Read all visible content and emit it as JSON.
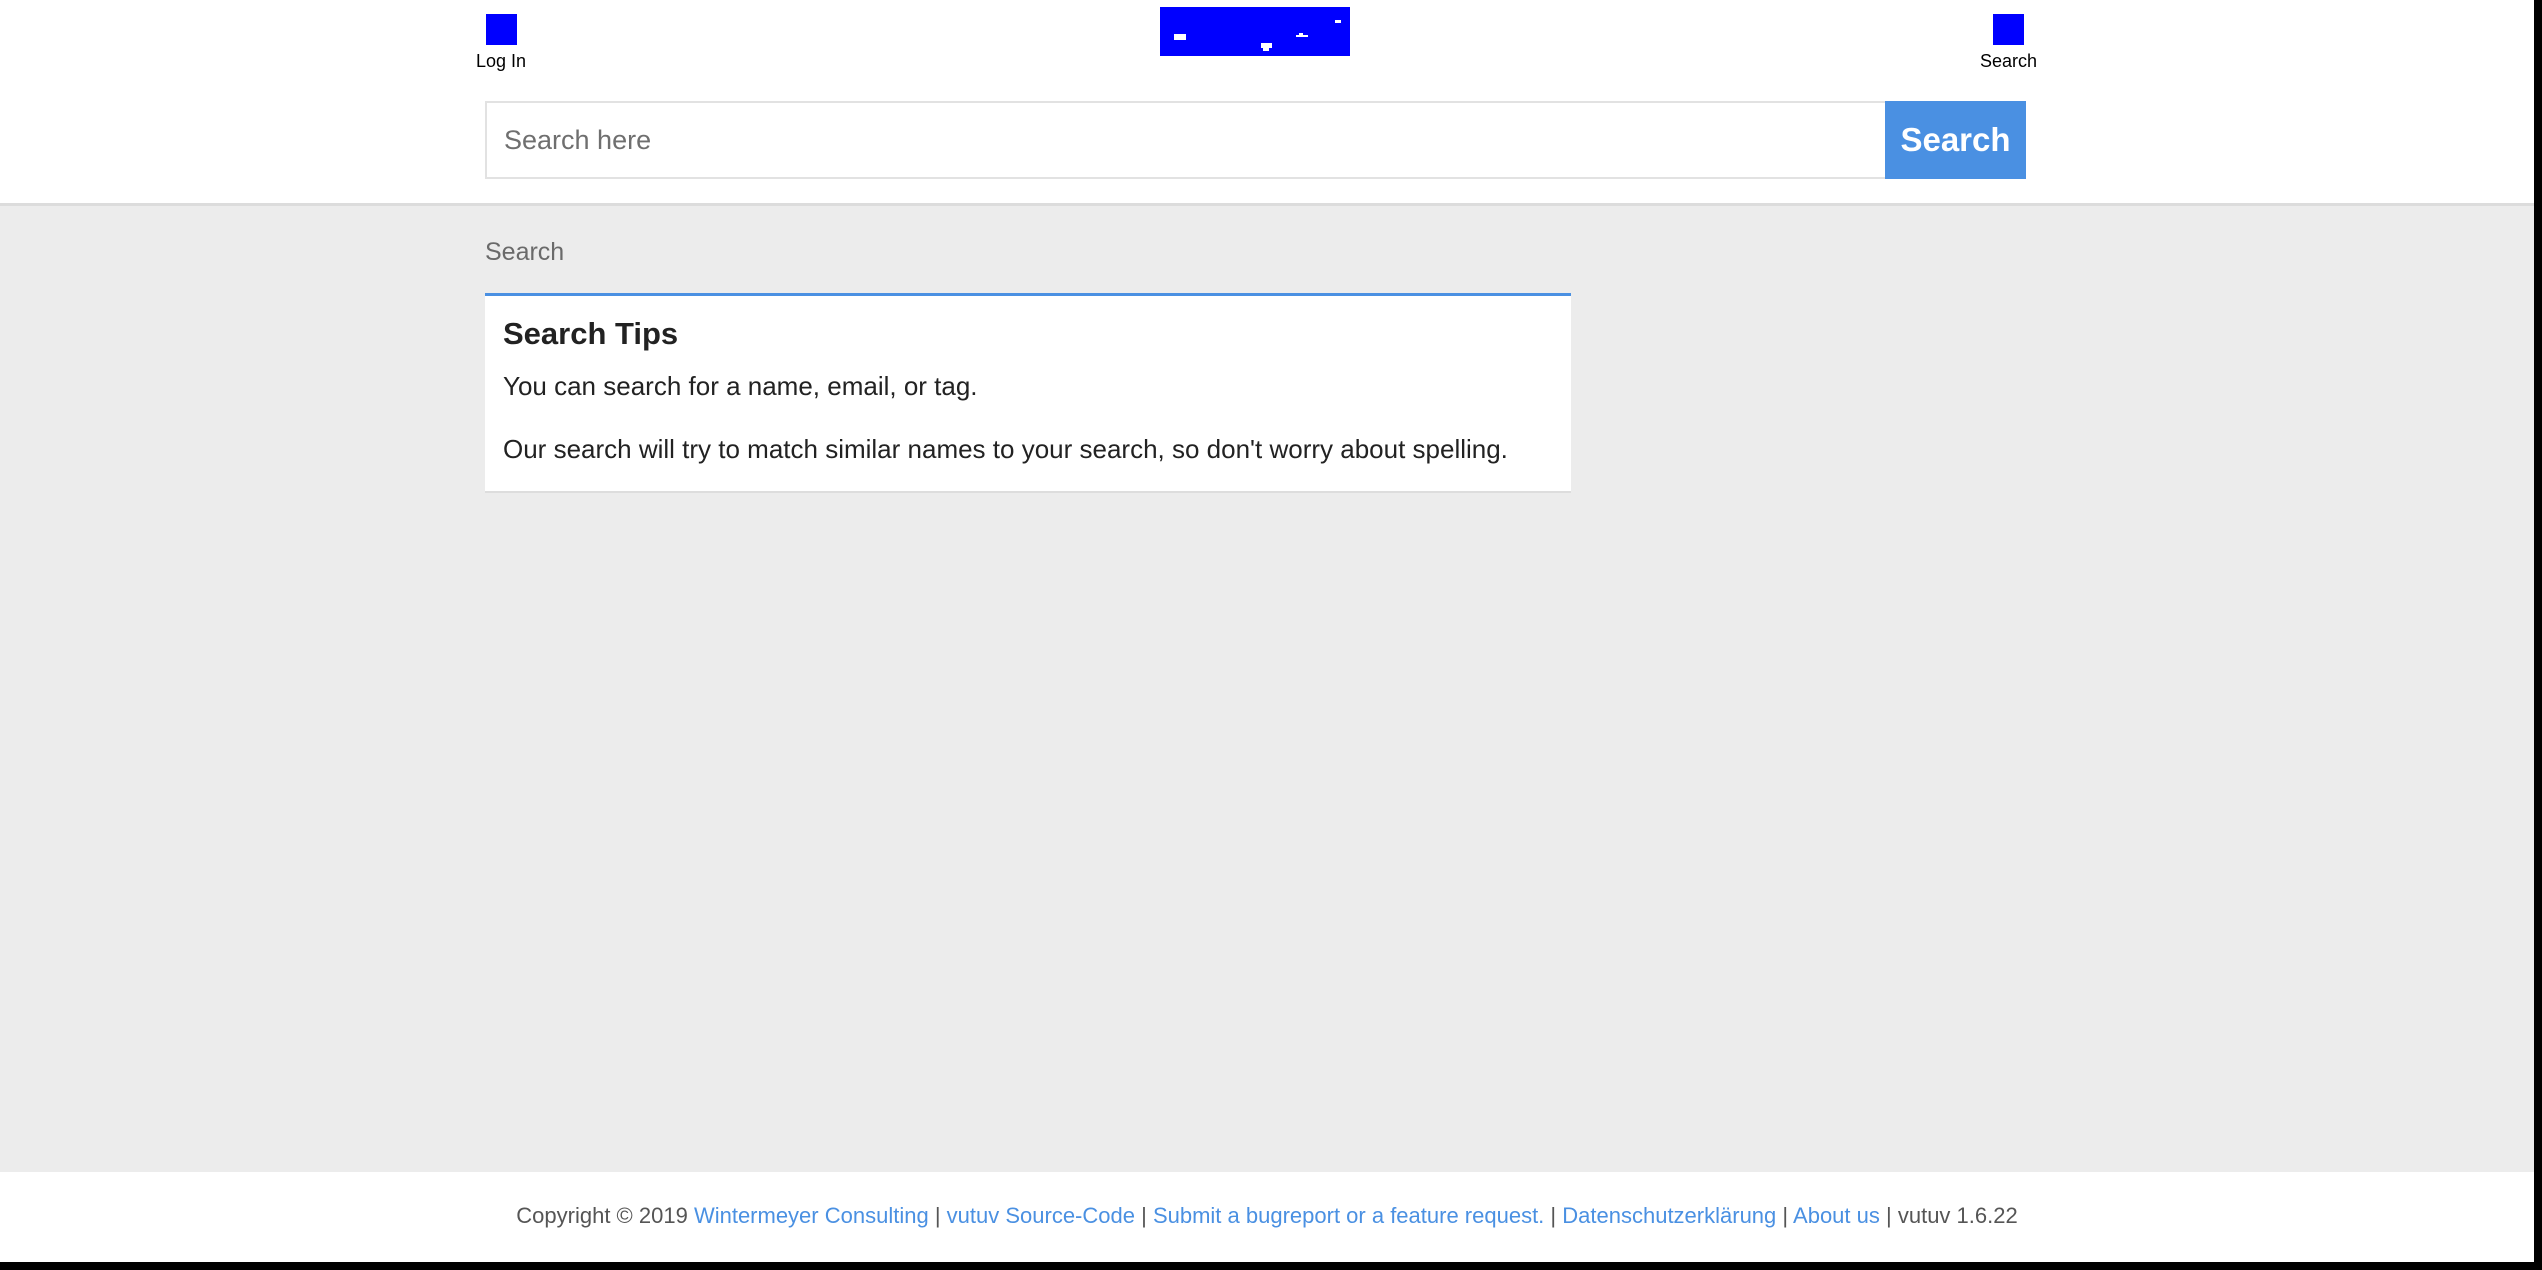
{
  "header": {
    "login": {
      "icon": "login-icon",
      "label": "Log In"
    },
    "logo": {
      "icon": "site-logo"
    },
    "search_link": {
      "icon": "search-icon",
      "label": "Search"
    },
    "search_form": {
      "placeholder": "Search here",
      "value": "",
      "button_label": "Search"
    }
  },
  "main": {
    "breadcrumb": "Search",
    "tips": {
      "title": "Search Tips",
      "lines": [
        "You can search for a name, email, or tag.",
        "Our search will try to match similar names to your search, so don't worry about spelling."
      ]
    }
  },
  "footer": {
    "copyright": "Copyright © 2019",
    "separator": "|",
    "links": [
      "Wintermeyer Consulting",
      "vutuv Source-Code",
      "Submit a bugreport or a feature request.",
      "Datenschutzerklärung",
      "About us"
    ],
    "version": "vutuv 1.6.22"
  },
  "colors": {
    "accent": "#4a90e2",
    "icon_placeholder": "#0000ff",
    "page_background": "#ececec",
    "header_background": "#ffffff"
  }
}
